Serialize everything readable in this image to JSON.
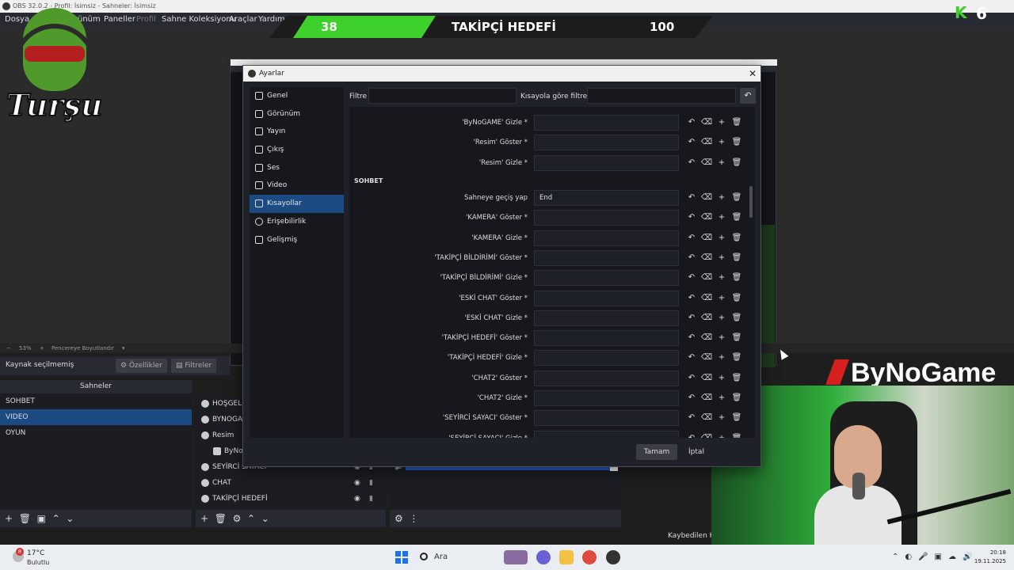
{
  "obs": {
    "title": "OBS 32.0.2 - Profil: İsimsiz - Sahneler: İsimsiz",
    "menus": [
      "Dosya",
      "Görünüm",
      "Paneller",
      "Profil",
      "Sahne Koleksiyonu",
      "Araçlar",
      "Yardım"
    ],
    "zoom": "53%",
    "fit_label": "Pencereye Boyutlandır",
    "source_status": "Kaynak seçilmemiş",
    "properties_btn": "Özellikler",
    "filters_btn": "Filtreler",
    "status_text": "Kaybedilen Ka"
  },
  "overlay": {
    "goal_current": "38",
    "goal_title": "TAKİPÇİ HEDEFİ",
    "goal_target": "100",
    "logo_word": "Turşu",
    "k_count": "6",
    "sponsor": "ByNoGame"
  },
  "scenes": {
    "header": "Sahneler",
    "items": [
      "SOHBET",
      "VIDEO",
      "OYUN"
    ],
    "active_index": 1
  },
  "sources": {
    "items": [
      "HOŞGELDİ",
      "BYNOGAM",
      "Resim",
      "ByNo",
      "SEYİRCİ SAYACI",
      "CHAT",
      "TAKİPÇİ HEDEFİ"
    ]
  },
  "dialog": {
    "title": "Ayarlar",
    "nav": [
      "Genel",
      "Görünüm",
      "Yayın",
      "Çıkış",
      "Ses",
      "Video",
      "Kısayollar",
      "Erişebilirlik",
      "Gelişmiş"
    ],
    "nav_active": 6,
    "filter_label": "Filtre",
    "filter_value": "",
    "hotkey_filter_label": "Kısayola göre filtrele",
    "hotkey_filter_value": "",
    "section": "SOHBET",
    "rows_before": [
      {
        "label": "'ByNoGAME' Gizle *",
        "value": ""
      },
      {
        "label": "'Resim' Göster *",
        "value": ""
      },
      {
        "label": "'Resim' Gizle *",
        "value": ""
      }
    ],
    "rows": [
      {
        "label": "Sahneye geçiş yap",
        "value": "End"
      },
      {
        "label": "'KAMERA' Göster *",
        "value": ""
      },
      {
        "label": "'KAMERA' Gizle *",
        "value": ""
      },
      {
        "label": "'TAKİPÇİ BİLDİRİMİ' Göster *",
        "value": ""
      },
      {
        "label": "'TAKİPÇİ BİLDİRİMİ' Gizle *",
        "value": ""
      },
      {
        "label": "'ESKİ CHAT' Göster *",
        "value": ""
      },
      {
        "label": "'ESKİ CHAT' Gizle *",
        "value": ""
      },
      {
        "label": "'TAKİPÇİ HEDEFİ' Göster *",
        "value": ""
      },
      {
        "label": "'TAKİPÇİ HEDEFİ' Gizle *",
        "value": ""
      },
      {
        "label": "'CHAT2' Göster *",
        "value": ""
      },
      {
        "label": "'CHAT2' Gizle *",
        "value": ""
      },
      {
        "label": "'SEYİRCİ SAYACI' Göster *",
        "value": ""
      },
      {
        "label": "'SEYİRCİ SAYACI' Gizle *",
        "value": ""
      }
    ],
    "ok": "Tamam",
    "cancel": "İptal"
  },
  "taskbar": {
    "weather_temp": "17°C",
    "weather_desc": "Bulutlu",
    "weather_badge": "8",
    "search_label": "Ara",
    "time": "20:18",
    "date": "19.11.2025"
  },
  "colors": {
    "accent_blue": "#1c4a83",
    "goal_green": "#3fd12b",
    "sponsor_red": "#d61f1f"
  }
}
